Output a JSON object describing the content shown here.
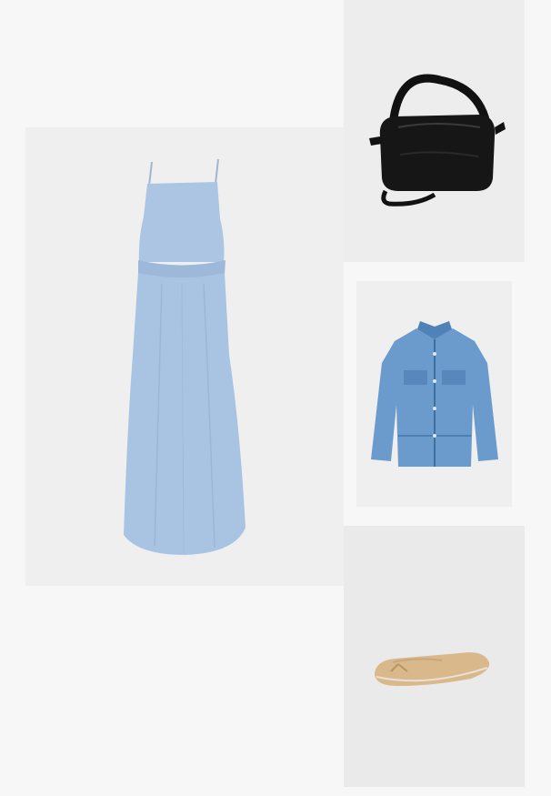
{
  "outfit": {
    "items": [
      {
        "name": "dress",
        "icon": "dress-icon",
        "color": "#a9c3e2"
      },
      {
        "name": "bag",
        "icon": "handbag-icon",
        "color": "#151515"
      },
      {
        "name": "jacket",
        "icon": "denim-jacket-icon",
        "color": "#5f93c6"
      },
      {
        "name": "shoes",
        "icon": "ballet-flat-icon",
        "color": "#d9b88c"
      }
    ]
  }
}
